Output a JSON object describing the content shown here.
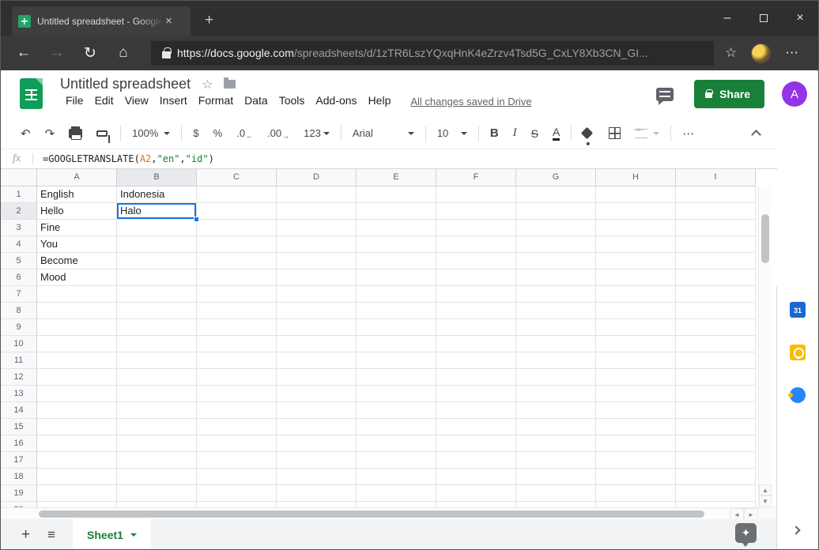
{
  "browser": {
    "tab": {
      "title": "Untitled spreadsheet - Google Sh",
      "close_glyph": "×"
    },
    "new_tab_glyph": "+",
    "window_controls": {
      "minimize": "–",
      "close": "×"
    },
    "nav": {
      "back": "←",
      "forward": "→",
      "refresh": "↻",
      "home": "⌂"
    },
    "address": {
      "url_host": "https://docs.google.com",
      "url_path": "/spreadsheets/d/1zTR6LszYQxqHnK4eZrzv4Tsd5G_CxLY8Xb3CN_GI...",
      "star_glyph": "☆",
      "more_glyph": "⋯"
    }
  },
  "app_header": {
    "title": "Untitled spreadsheet",
    "star_glyph": "☆",
    "menus": [
      "File",
      "Edit",
      "View",
      "Insert",
      "Format",
      "Data",
      "Tools",
      "Add-ons",
      "Help"
    ],
    "save_status": "All changes saved in Drive",
    "share_label": "Share",
    "avatar_letter": "A"
  },
  "toolbar": {
    "undo_glyph": "↶",
    "redo_glyph": "↷",
    "zoom": "100%",
    "currency": "$",
    "percent": "%",
    "decrease_decimal": ".0",
    "decrease_arrow": "←",
    "increase_decimal": ".00",
    "increase_arrow": "→",
    "more_formats": "123",
    "font": "Arial",
    "font_size": "10",
    "bold": "B",
    "italic": "I",
    "strikethrough": "S",
    "text_color": "A",
    "more_glyph": "⋯"
  },
  "formula_bar": {
    "fx_label": "fx",
    "formula_text": "=GOOGLETRANSLATE(A2,\"en\",\"id\")",
    "tokens": [
      {
        "text": "=GOOGLETRANSLATE(",
        "color": "#202124"
      },
      {
        "text": "A2",
        "color": "#e8710a"
      },
      {
        "text": ",",
        "color": "#202124"
      },
      {
        "text": "\"en\"",
        "color": "#188038"
      },
      {
        "text": ",",
        "color": "#202124"
      },
      {
        "text": "\"id\"",
        "color": "#188038"
      },
      {
        "text": ")",
        "color": "#202124"
      }
    ]
  },
  "grid": {
    "columns": [
      "A",
      "B",
      "C",
      "D",
      "E",
      "F",
      "G",
      "H",
      "I"
    ],
    "row_count": 20,
    "cells": {
      "A1": "English",
      "B1": "Indonesia",
      "A2": "Hello",
      "B2": "Halo",
      "A3": "Fine",
      "A4": "You",
      "A5": "Become",
      "A6": "Mood"
    },
    "selected_cell": "B2",
    "selected_column": "B",
    "selected_row": 2
  },
  "sheet_bar": {
    "add_glyph": "+",
    "all_sheets_glyph": "≡",
    "tabs": [
      {
        "name": "Sheet1",
        "active": true
      }
    ],
    "explore_glyph": "✦"
  },
  "side_panel": {
    "calendar_day": "31",
    "icons": [
      "google-calendar",
      "google-keep",
      "google-tasks"
    ]
  },
  "colors": {
    "selection_blue": "#1a73e8",
    "share_green": "#188038",
    "sheets_green": "#0f9d58",
    "avatar_purple": "#9334e6"
  }
}
